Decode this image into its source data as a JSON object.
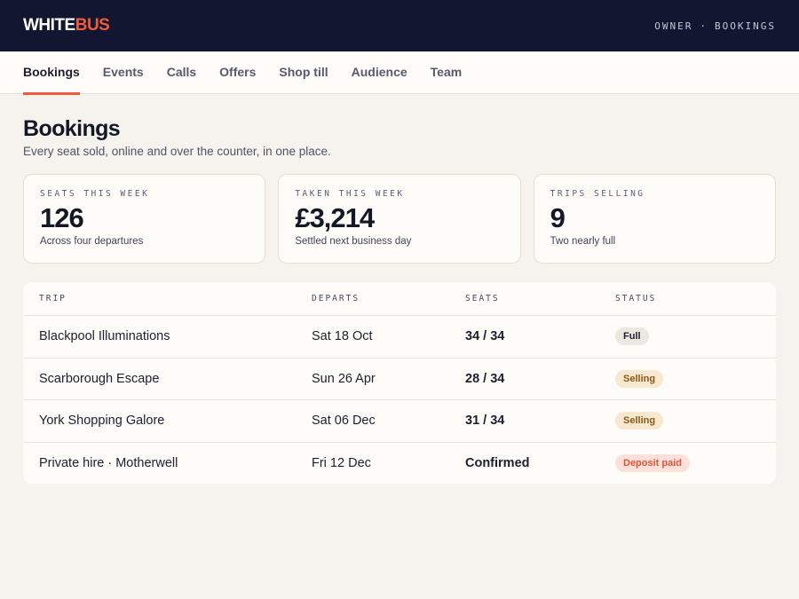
{
  "brand": {
    "part1": "WHITE",
    "part2": "BUS"
  },
  "breadcrumb": [
    "OWNER",
    "·",
    "BOOKINGS"
  ],
  "nav": {
    "tabs": [
      {
        "label": "Bookings",
        "active": true
      },
      {
        "label": "Events",
        "active": false
      },
      {
        "label": "Calls",
        "active": false
      },
      {
        "label": "Offers",
        "active": false
      },
      {
        "label": "Shop till",
        "active": false
      },
      {
        "label": "Audience",
        "active": false
      },
      {
        "label": "Team",
        "active": false
      }
    ]
  },
  "page": {
    "title": "Bookings",
    "subtitle": "Every seat sold, online and over the counter, in one place."
  },
  "stats": [
    {
      "label": "SEATS THIS WEEK",
      "value": "126",
      "note": "Across four departures"
    },
    {
      "label": "TAKEN THIS WEEK",
      "value": "£3,214",
      "note": "Settled next business day"
    },
    {
      "label": "TRIPS SELLING",
      "value": "9",
      "note": "Two nearly full"
    }
  ],
  "table": {
    "columns": [
      "TRIP",
      "DEPARTS",
      "SEATS",
      "STATUS"
    ],
    "rows": [
      {
        "trip": "Blackpool Illuminations",
        "departs": "Sat 18 Oct",
        "seats": "34 / 34",
        "status": "Full"
      },
      {
        "trip": "Scarborough Escape",
        "departs": "Sun 26 Apr",
        "seats": "28 / 34",
        "status": "Selling"
      },
      {
        "trip": "York Shopping Galore",
        "departs": "Sat 06 Dec",
        "seats": "31 / 34",
        "status": "Selling"
      },
      {
        "trip": "Private hire · Motherwell",
        "departs": "Fri 12 Dec",
        "seats": "Confirmed",
        "status": "Deposit paid"
      }
    ]
  },
  "colors": {
    "topbar": "#121631",
    "accent": "#ef5b3d",
    "background": "#f6f3ee",
    "badge_full": "#ebe8e2",
    "badge_selling": "#f7e8cf",
    "badge_deposit": "#fbe1d9"
  }
}
